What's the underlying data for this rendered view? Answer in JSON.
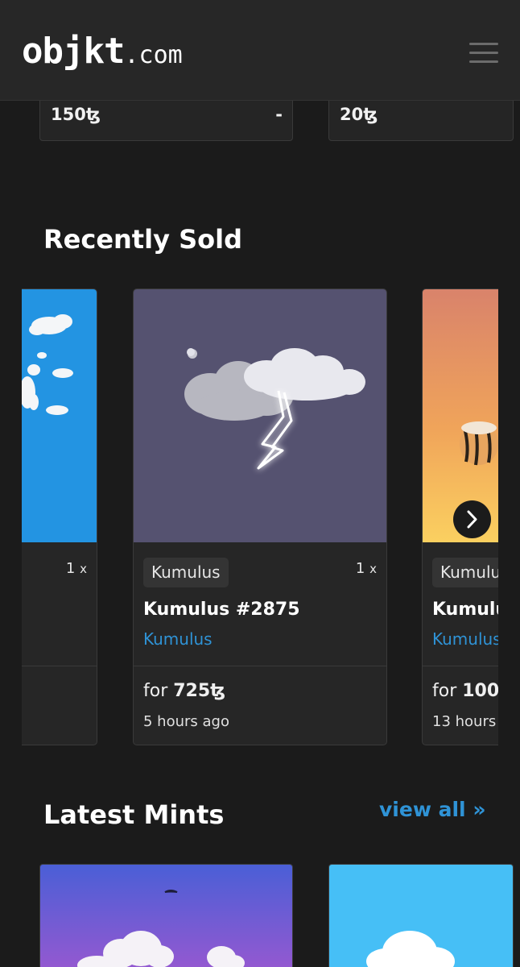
{
  "header": {
    "logo_main": "objkt",
    "logo_suffix": ".com",
    "menu_icon": "hamburger-menu-icon"
  },
  "listings": [
    {
      "price": "150ꜩ",
      "extra": "-"
    },
    {
      "price": "20ꜩ"
    }
  ],
  "recently_sold": {
    "title": "Recently Sold",
    "cards": [
      {
        "tag": "",
        "edition": "1",
        "edition_suffix": "x",
        "name": "",
        "artist": "",
        "sale_prefix": "",
        "sale_amount": "",
        "time": ""
      },
      {
        "tag": "Kumulus",
        "edition": "1",
        "edition_suffix": "x",
        "name": "Kumulus #2875",
        "artist": "Kumulus",
        "sale_prefix": "for ",
        "sale_amount": "725ꜩ",
        "time": "5 hours ago"
      },
      {
        "tag": "Kumulu",
        "edition": "",
        "edition_suffix": "",
        "name": "Kumulu",
        "artist": "Kumulus",
        "sale_prefix": "for ",
        "sale_amount": "100",
        "time": "13 hours"
      }
    ],
    "next_icon": "chevron-right-icon"
  },
  "latest_mints": {
    "title": "Latest Mints",
    "view_all": "view all »"
  },
  "colors": {
    "background": "#1b1b1b",
    "card": "#262626",
    "accent_link": "#2f93d6"
  }
}
